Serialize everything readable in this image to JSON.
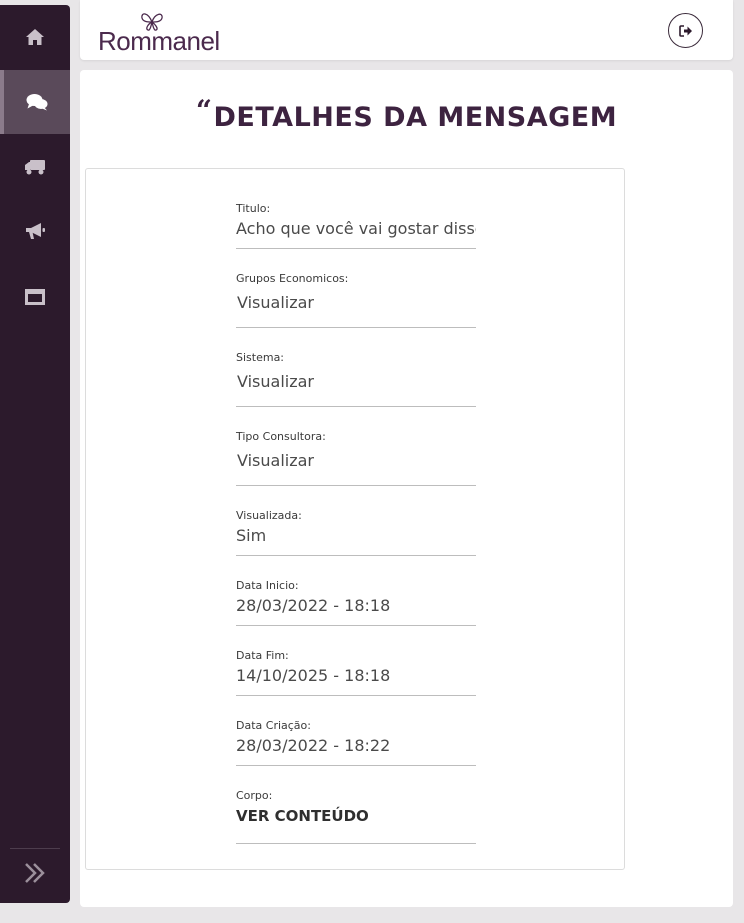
{
  "app": {
    "brand": "Rommanel"
  },
  "sidebar": {
    "items": [
      {
        "name": "home",
        "icon": "home-icon"
      },
      {
        "name": "messages",
        "icon": "chat-bubbles-icon",
        "active": true
      },
      {
        "name": "delivery",
        "icon": "truck-icon"
      },
      {
        "name": "announcements",
        "icon": "megaphone-icon"
      },
      {
        "name": "window",
        "icon": "window-icon"
      }
    ],
    "expand_icon": "double-chevron-right-icon"
  },
  "header": {
    "logout_icon": "sign-out-icon"
  },
  "page": {
    "quote": "“",
    "title": "DETALHES DA MENSAGEM"
  },
  "fields": {
    "titulo": {
      "label": "Titulo:",
      "value": "Acho que você vai gostar disso"
    },
    "grupos": {
      "label": "Grupos Economicos:",
      "value": "Visualizar"
    },
    "sistema": {
      "label": "Sistema:",
      "value": "Visualizar"
    },
    "tipo": {
      "label": "Tipo Consultora:",
      "value": "Visualizar"
    },
    "visualizada": {
      "label": "Visualizada:",
      "value": "Sim"
    },
    "inicio": {
      "label": "Data Inicio:",
      "value": "28/03/2022 - 18:18"
    },
    "fim": {
      "label": "Data Fim:",
      "value": "14/10/2025 - 18:18"
    },
    "criacao": {
      "label": "Data Criação:",
      "value": "28/03/2022 - 18:22"
    },
    "corpo": {
      "label": "Corpo:",
      "value": "VER CONTEÚDO"
    }
  },
  "colors": {
    "sidebar_bg": "#2c1a2c",
    "sidebar_active": "#5a4a5a",
    "brand": "#4b2a4d",
    "title": "#3d2340"
  }
}
